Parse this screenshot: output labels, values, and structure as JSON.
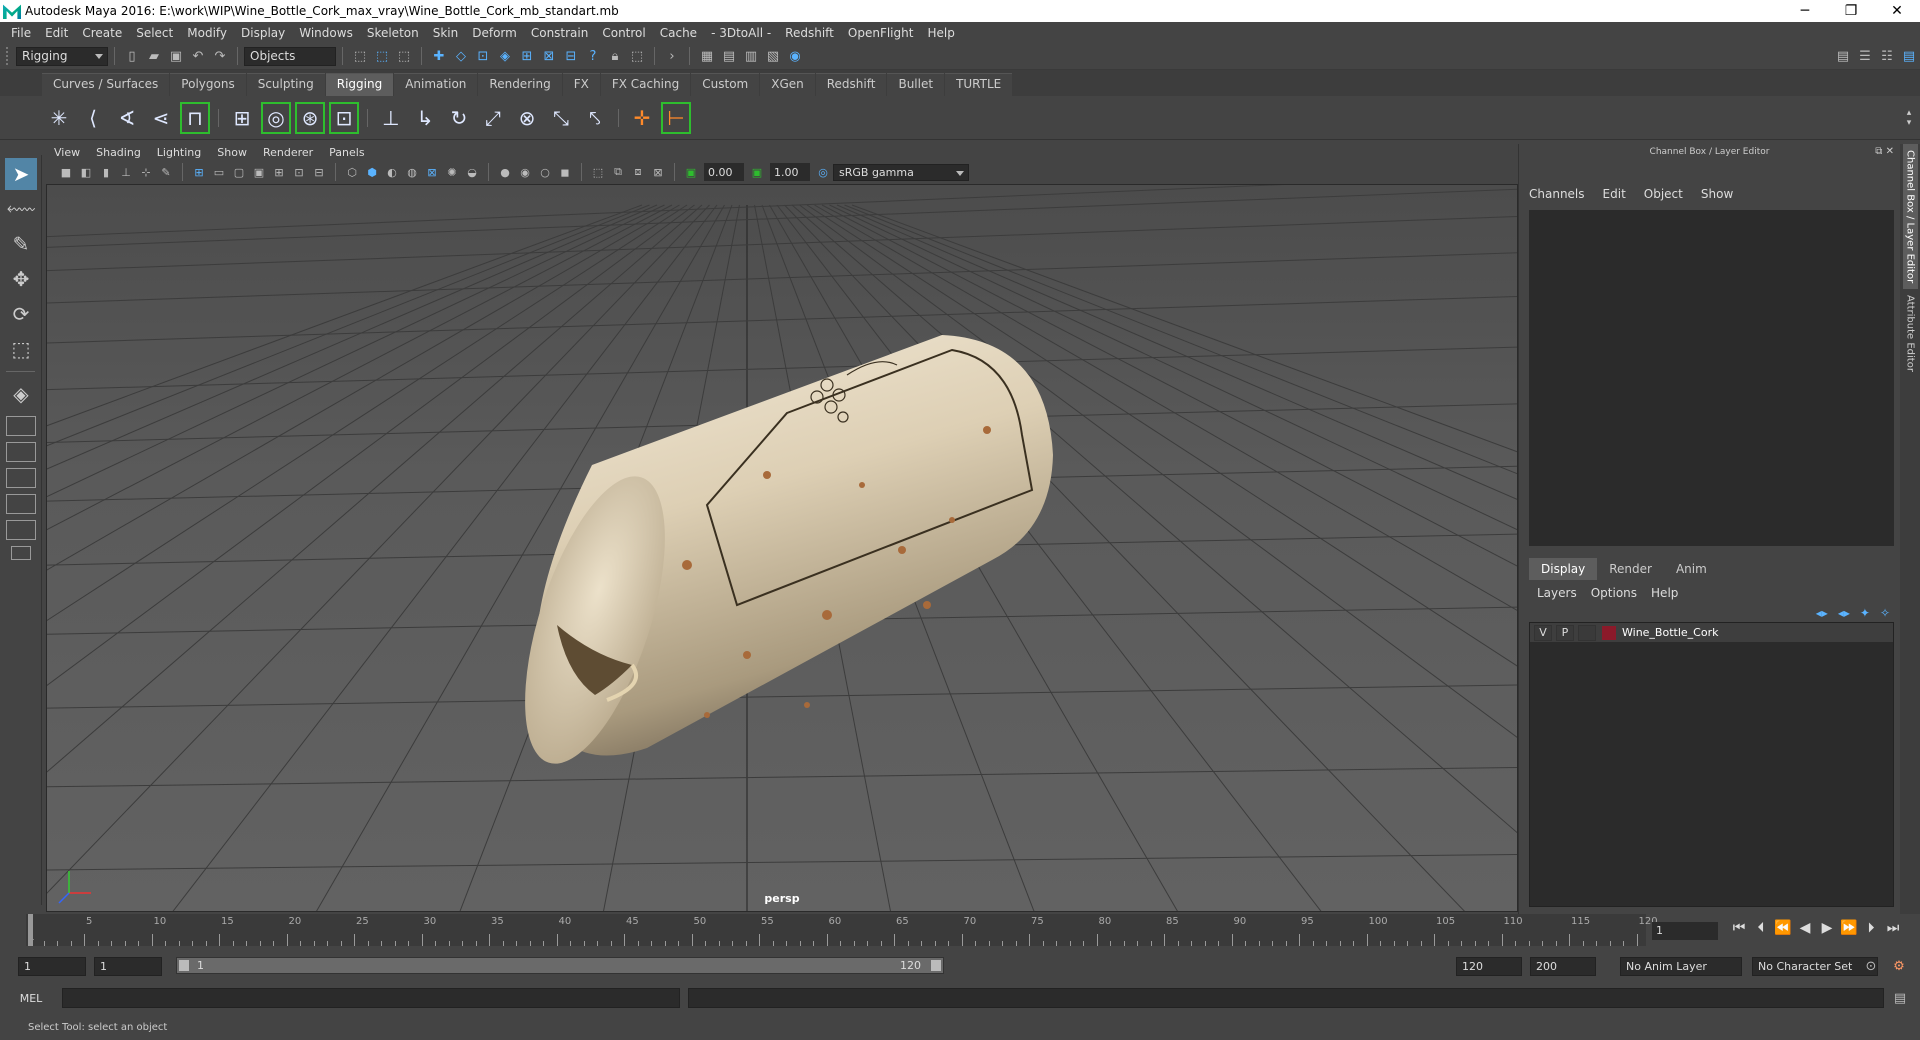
{
  "window": {
    "title": "Autodesk Maya 2016: E:\\work\\WIP\\Wine_Bottle_Cork_max_vray\\Wine_Bottle_Cork_mb_standart.mb",
    "minimize": "─",
    "restore": "❐",
    "close": "✕"
  },
  "menubar": [
    "File",
    "Edit",
    "Create",
    "Select",
    "Modify",
    "Display",
    "Windows",
    "Skeleton",
    "Skin",
    "Deform",
    "Constrain",
    "Control",
    "Cache",
    "- 3DtoAll -",
    "Redshift",
    "OpenFlight",
    "Help"
  ],
  "statusline": {
    "menuset": "Rigging",
    "selection_mode": "Objects"
  },
  "shelf_tabs": [
    "Curves / Surfaces",
    "Polygons",
    "Sculpting",
    "Rigging",
    "Animation",
    "Rendering",
    "FX",
    "FX Caching",
    "Custom",
    "XGen",
    "Redshift",
    "Bullet",
    "TURTLE"
  ],
  "active_shelf_tab": "Rigging",
  "viewport": {
    "menu": [
      "View",
      "Shading",
      "Lighting",
      "Show",
      "Renderer",
      "Panels"
    ],
    "exposure": "0.00",
    "gamma": "1.00",
    "color_space": "sRGB gamma",
    "camera": "persp"
  },
  "channel_box": {
    "title": "Channel Box / Layer Editor",
    "menu": [
      "Channels",
      "Edit",
      "Object",
      "Show"
    ]
  },
  "layer_editor": {
    "tabs": [
      "Display",
      "Render",
      "Anim"
    ],
    "active_tab": "Display",
    "menu": [
      "Layers",
      "Options",
      "Help"
    ],
    "layers": [
      {
        "v": "V",
        "p": "P",
        "name": "Wine_Bottle_Cork",
        "color": "#8b1a2a"
      }
    ]
  },
  "side_tabs": [
    "Channel Box / Layer Editor",
    "Attribute Editor"
  ],
  "timeline": {
    "labels": [
      "5",
      "10",
      "15",
      "20",
      "25",
      "30",
      "35",
      "40",
      "45",
      "50",
      "55",
      "60",
      "65",
      "70",
      "75",
      "80",
      "85",
      "90",
      "95",
      "100",
      "105",
      "110",
      "115",
      "120"
    ],
    "start_label": "1",
    "current_frame": "1"
  },
  "range": {
    "start": "1",
    "playback_start": "1",
    "range_start_label": "1",
    "range_end_label": "120",
    "playback_end": "120",
    "end": "200",
    "anim_layer": "No Anim Layer",
    "character_set": "No Character Set"
  },
  "command": {
    "label": "MEL"
  },
  "help_line": "Select Tool: select an object",
  "colors": {
    "accent": "#5285a6",
    "shelf_highlight": "#2ebd2e",
    "layer_color": "#8b1a2a"
  }
}
